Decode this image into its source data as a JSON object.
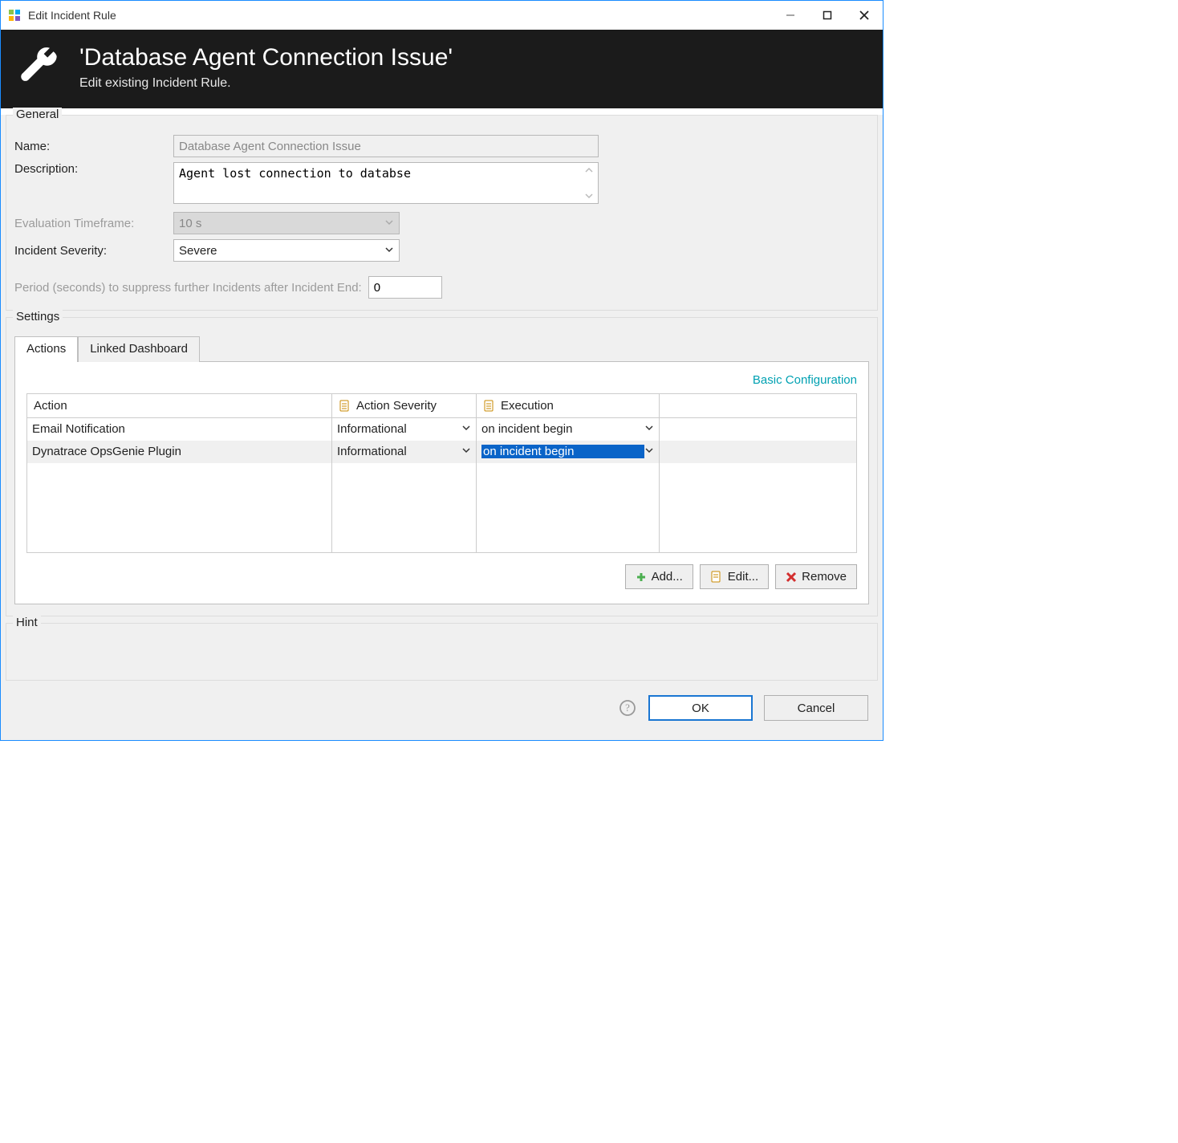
{
  "window": {
    "title": "Edit Incident Rule"
  },
  "banner": {
    "title": "'Database Agent Connection Issue'",
    "subtitle": "Edit existing Incident Rule."
  },
  "groups": {
    "general": "General",
    "settings": "Settings",
    "hint": "Hint"
  },
  "general": {
    "name_label": "Name:",
    "name_value": "Database Agent Connection Issue",
    "description_label": "Description:",
    "description_value": "Agent lost connection to databse",
    "eval_timeframe_label": "Evaluation Timeframe:",
    "eval_timeframe_value": "10 s",
    "severity_label": "Incident Severity:",
    "severity_value": "Severe",
    "suppress_label": "Period (seconds) to suppress further Incidents after Incident End:",
    "suppress_value": "0"
  },
  "settings": {
    "tabs": {
      "actions": "Actions",
      "linked_dashboard": "Linked Dashboard"
    },
    "basic_link": "Basic Configuration",
    "table": {
      "headers": {
        "action": "Action",
        "severity": "Action Severity",
        "execution": "Execution"
      },
      "rows": [
        {
          "action": "Email Notification",
          "severity": "Informational",
          "execution": "on incident begin",
          "selected": false,
          "highlight": false
        },
        {
          "action": "Dynatrace OpsGenie Plugin",
          "severity": "Informational",
          "execution": "on incident begin",
          "selected": true,
          "highlight": true
        }
      ]
    },
    "buttons": {
      "add": "Add...",
      "edit": "Edit...",
      "remove": "Remove"
    }
  },
  "footer": {
    "ok": "OK",
    "cancel": "Cancel"
  }
}
